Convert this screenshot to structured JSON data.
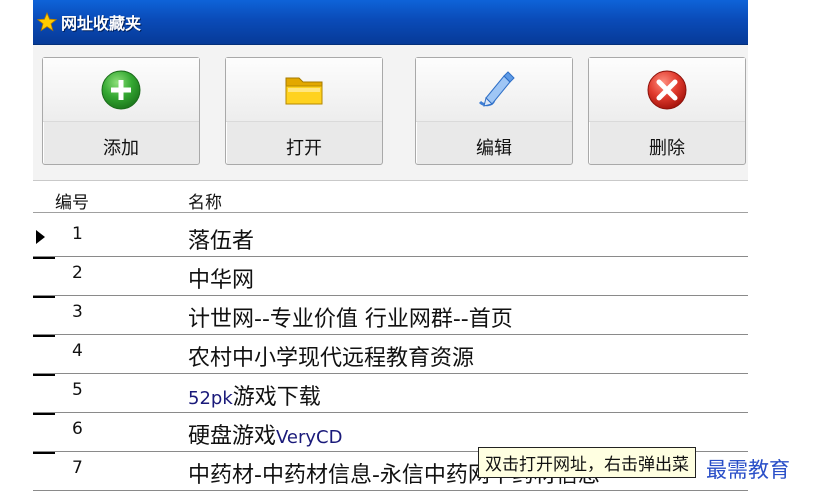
{
  "window": {
    "title": "网址收藏夹"
  },
  "toolbar": {
    "buttons": [
      {
        "label": "添加",
        "icon": "add-icon"
      },
      {
        "label": "打开",
        "icon": "folder-open-icon"
      },
      {
        "label": "编辑",
        "icon": "edit-icon"
      },
      {
        "label": "删除",
        "icon": "delete-icon"
      }
    ]
  },
  "table": {
    "columns": [
      "编号",
      "名称"
    ],
    "rows": [
      {
        "id": "1",
        "name": "落伍者",
        "selected": true
      },
      {
        "id": "2",
        "name": "中华网"
      },
      {
        "id": "3",
        "name": "计世网--专业价值 行业网群--首页"
      },
      {
        "id": "4",
        "name": "农村中小学现代远程教育资源"
      },
      {
        "id": "5",
        "name_prefix": "52pk",
        "name_suffix": "游戏下载"
      },
      {
        "id": "6",
        "name_prefix": "硬盘游戏",
        "name_suffix": "VeryCD"
      },
      {
        "id": "7",
        "name": "中药材-中药材信息-永信中药网中药材信息"
      }
    ]
  },
  "tooltip": {
    "text": "双击打开网址，右击弹出菜"
  },
  "watermark": {
    "text": "最需教育"
  },
  "colors": {
    "titlebar": "#0a4bb8",
    "add": "#2e9e2e",
    "folder": "#f5c400",
    "delete": "#d9342b",
    "accent_text": "#1a1a7a"
  }
}
